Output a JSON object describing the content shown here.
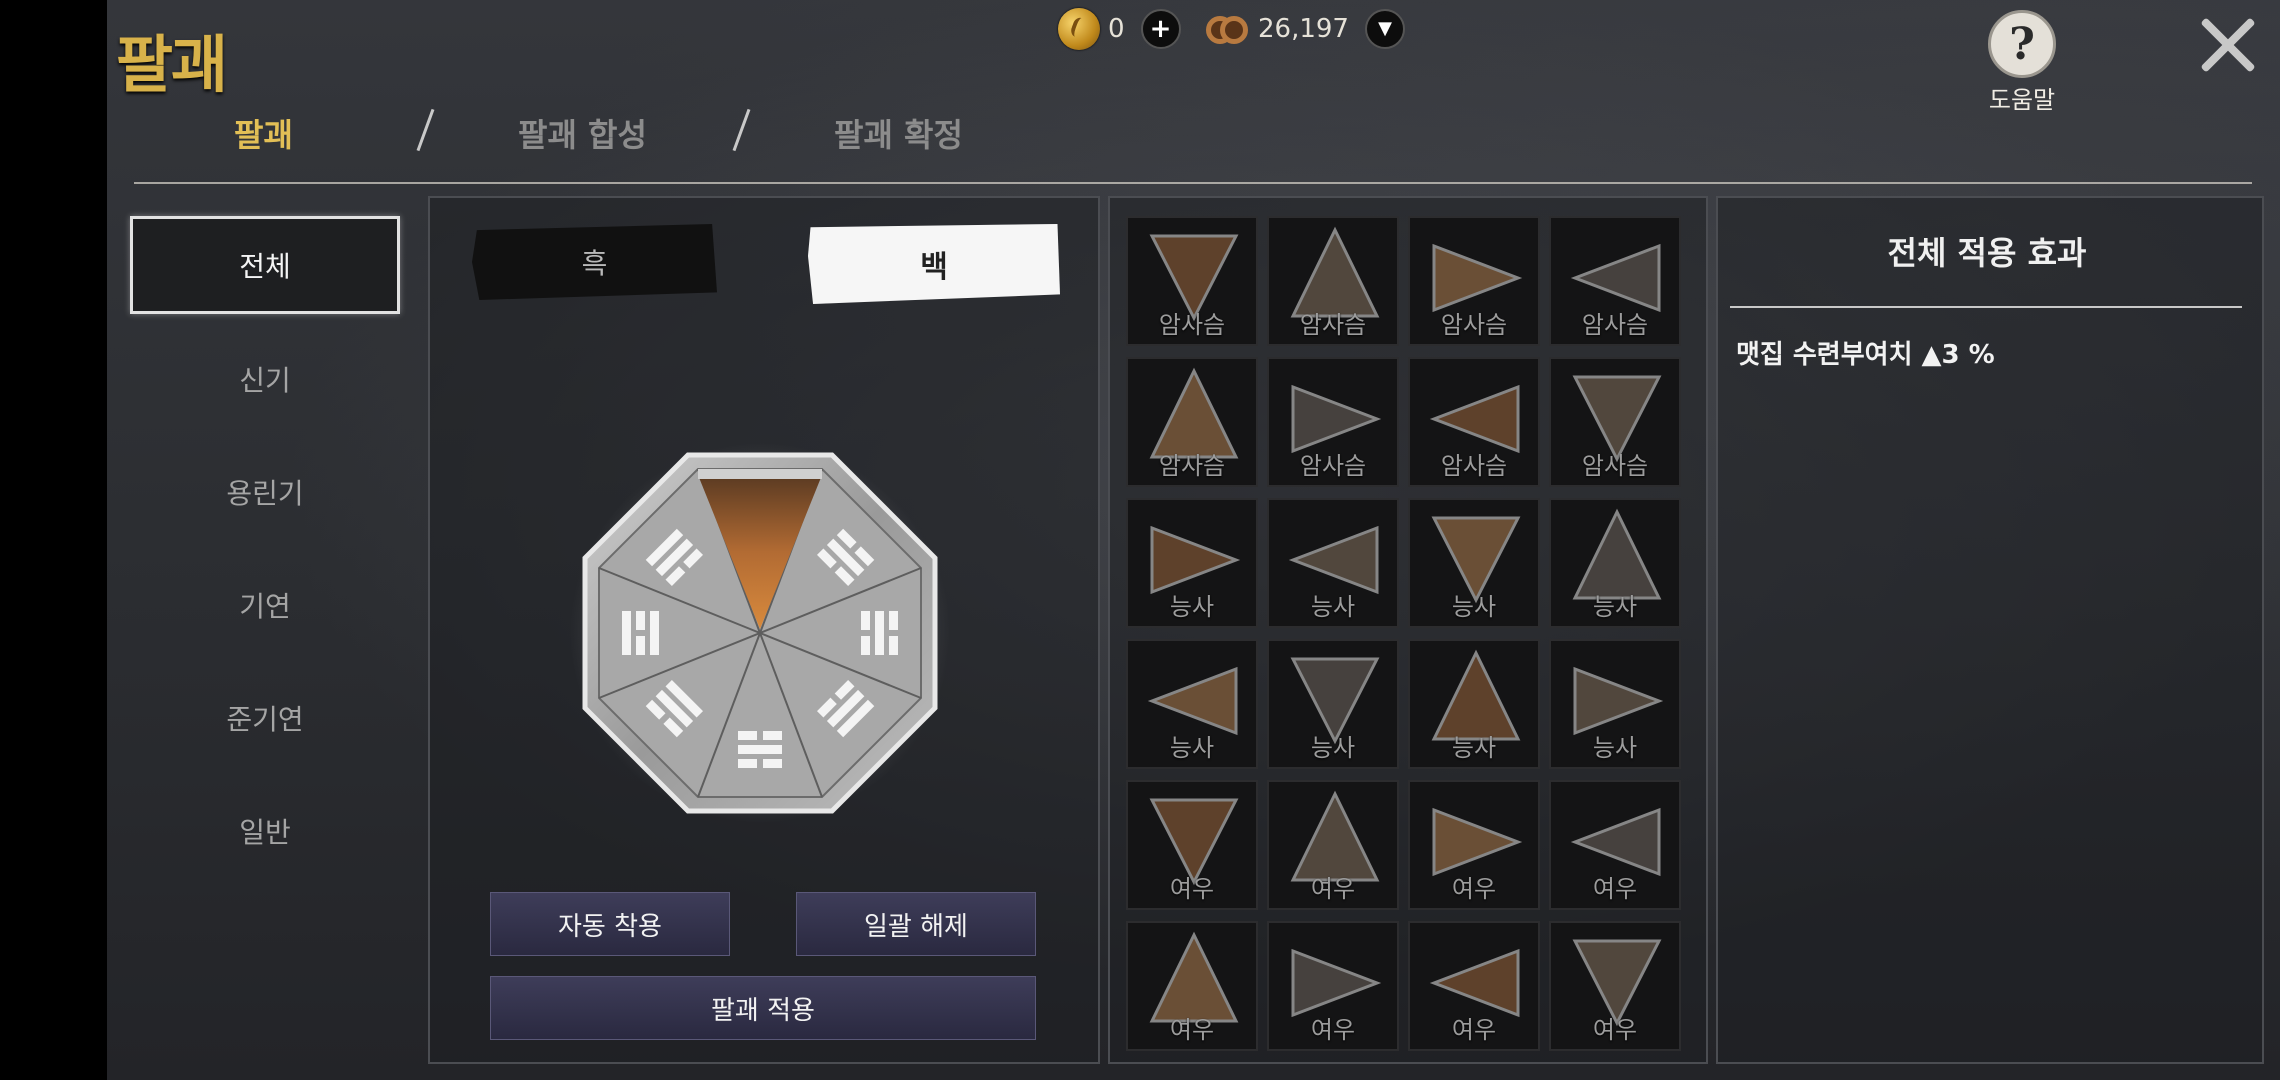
{
  "header": {
    "title": "팔괘",
    "currency_gold": "0",
    "currency_beads": "26,197",
    "help_label": "도움말"
  },
  "tabs": [
    {
      "label": "팔괘"
    },
    {
      "label": "팔괘 합성"
    },
    {
      "label": "팔괘 확정"
    }
  ],
  "categories": [
    {
      "label": "전체"
    },
    {
      "label": "신기"
    },
    {
      "label": "용린기"
    },
    {
      "label": "기연"
    },
    {
      "label": "준기연"
    },
    {
      "label": "일반"
    }
  ],
  "toggle": {
    "black_label": "흑",
    "white_label": "백"
  },
  "actions": {
    "auto_equip": "자동 착용",
    "unequip_all": "일괄 해제",
    "apply": "팔괘 적용"
  },
  "inventory": {
    "rows": [
      [
        "암사슴",
        "암사슴",
        "암사슴",
        "암사슴"
      ],
      [
        "암사슴",
        "암사슴",
        "암사슴",
        "암사슴"
      ],
      [
        "능사",
        "능사",
        "능사",
        "능사"
      ],
      [
        "능사",
        "능사",
        "능사",
        "능사"
      ],
      [
        "여우",
        "여우",
        "여우",
        "여우"
      ],
      [
        "여우",
        "여우",
        "여우",
        "여우"
      ]
    ]
  },
  "effects_panel": {
    "title": "전체 적용 효과",
    "effects": [
      "맷집 수련부여치 ▲3 %"
    ]
  }
}
